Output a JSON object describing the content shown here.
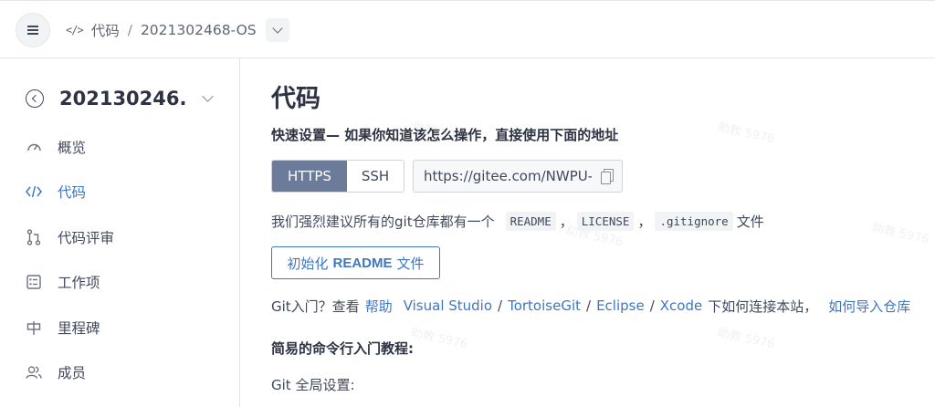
{
  "topbar": {
    "breadcrumb_section": "代码",
    "breadcrumb_separator": "/",
    "breadcrumb_repo": "2021302468-OS"
  },
  "sidebar": {
    "repo_name": "202130246...",
    "items": [
      {
        "label": "概览",
        "icon": "dashboard-icon"
      },
      {
        "label": "代码",
        "icon": "code-icon",
        "active": true
      },
      {
        "label": "代码评审",
        "icon": "pull-request-icon"
      },
      {
        "label": "工作项",
        "icon": "task-list-icon"
      },
      {
        "label": "里程碑",
        "icon": "milestone-icon"
      },
      {
        "label": "成员",
        "icon": "members-icon"
      }
    ]
  },
  "main": {
    "title": "代码",
    "subtitle": "快速设置— 如果你知道该怎么操作，直接使用下面的地址",
    "protocols": {
      "https": "HTTPS",
      "ssh": "SSH",
      "selected": "HTTPS"
    },
    "clone_url": "https://gitee.com/NWPU-C",
    "recommend": {
      "prefix": "我们强烈建议所有的git仓库都有一个",
      "files": [
        "README",
        "LICENSE",
        ".gitignore"
      ],
      "sep1": "，",
      "sep2": "，",
      "suffix": "文件"
    },
    "init_button": {
      "prefix": "初始化",
      "bold": "README",
      "suffix": "文件"
    },
    "help": {
      "prefix": "Git入门？查看",
      "help_link": "帮助",
      "links": [
        "Visual Studio",
        "TortoiseGit",
        "Eclipse",
        "Xcode"
      ],
      "slash": "/",
      "middle": "下如何连接本站，",
      "import_link": "如何导入仓库"
    },
    "cli_title": "简易的命令行入门教程:",
    "global_settings": "Git 全局设置:"
  },
  "watermark": "助教 5976",
  "colors": {
    "accent": "#3f76c1",
    "protocol_selected": "#6b7b99",
    "text": "#40485b"
  }
}
